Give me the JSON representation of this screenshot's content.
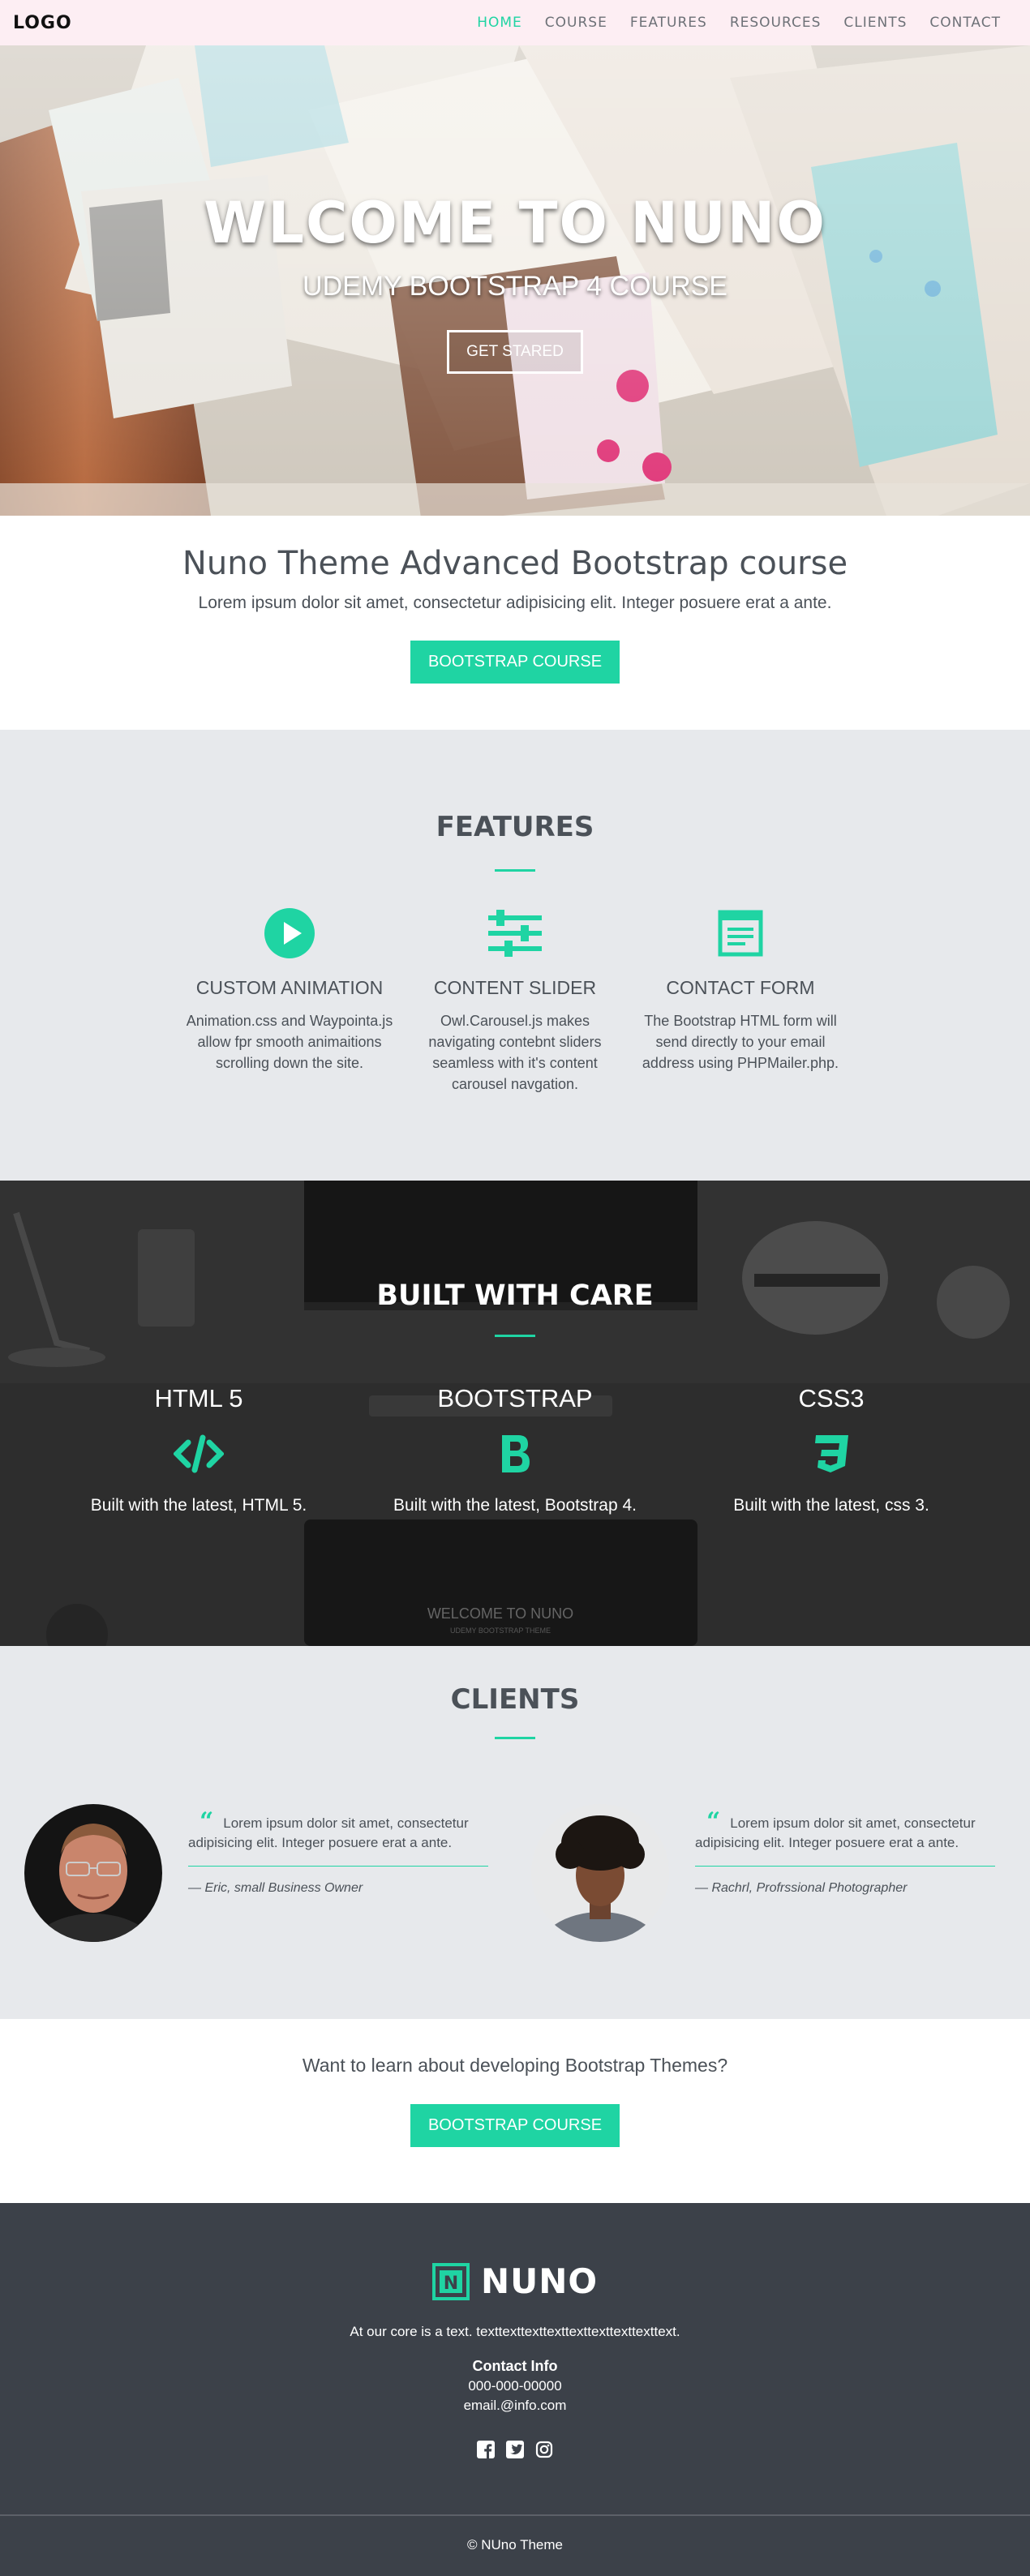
{
  "nav": {
    "logo": "LOGO",
    "links": [
      {
        "label": "HOME",
        "active": true
      },
      {
        "label": "COURSE"
      },
      {
        "label": "FEATURES"
      },
      {
        "label": "RESOURCES"
      },
      {
        "label": "CLIENTS"
      },
      {
        "label": "CONTACT"
      }
    ]
  },
  "hero": {
    "title": "WLCOME TO NUNO",
    "subtitle": "UDEMY BOOTSTRAP 4 COURSE",
    "button": "GET STARED"
  },
  "intro": {
    "title": "Nuno Theme Advanced Bootstrap course",
    "text": "Lorem ipsum dolor sit amet, consectetur adipisicing elit. Integer posuere erat a ante.",
    "button": "BOOTSTRAP COURSE"
  },
  "features": {
    "title": "FEATURES",
    "items": [
      {
        "icon": "play-circle-icon",
        "title": "CUSTOM ANIMATION",
        "text": "Animation.css and Waypointa.js allow fpr smooth animaitions scrolling down the site."
      },
      {
        "icon": "sliders-icon",
        "title": "CONTENT SLIDER",
        "text": "Owl.Carousel.js makes navigating contebnt sliders seamless with it's content carousel navgation."
      },
      {
        "icon": "form-icon",
        "title": "CONTACT FORM",
        "text": "The Bootstrap HTML form will send directly to your email address using PHPMailer.php."
      }
    ]
  },
  "built": {
    "title": "BUILT WITH CARE",
    "items": [
      {
        "title": "HTML 5",
        "icon": "code-icon",
        "text": "Built with the latest, HTML 5."
      },
      {
        "title": "BOOTSTRAP",
        "icon": "bootstrap-icon",
        "text": "Built with the latest, Bootstrap 4."
      },
      {
        "title": "CSS3",
        "icon": "css3-icon",
        "text": "Built with the latest, css 3."
      }
    ],
    "screen_title": "WELCOME TO NUNO",
    "screen_sub": "UDEMY BOOTSTRAP THEME"
  },
  "clients": {
    "title": "CLIENTS",
    "items": [
      {
        "quote": "Lorem ipsum dolor sit amet, consectetur adipisicing elit. Integer posuere erat a ante.",
        "author": "— Eric, small Business Owner"
      },
      {
        "quote": "Lorem ipsum dolor sit amet, consectetur adipisicing elit. Integer posuere erat a ante.",
        "author": "— Rachrl, Profrssional Photographer"
      }
    ]
  },
  "cta": {
    "text": "Want to learn about developing Bootstrap Themes?",
    "button": "BOOTSTRAP COURSE"
  },
  "footer": {
    "brand": "NUNO",
    "brand_letter": "N",
    "text": "At our core is a text. texttexttexttexttexttexttexttexttext.",
    "contact_title": "Contact Info",
    "phone": "000-000-00000",
    "email": "email.@info.com",
    "socials": [
      "facebook-icon",
      "twitter-icon",
      "instagram-icon"
    ],
    "copyright": "© NUno Theme"
  },
  "colors": {
    "accent": "#1fd4a3",
    "navbar_bg": "#fdeef3",
    "section_gray": "#e7e9ec",
    "footer_bg": "#3c4149",
    "text": "#4b5158"
  }
}
